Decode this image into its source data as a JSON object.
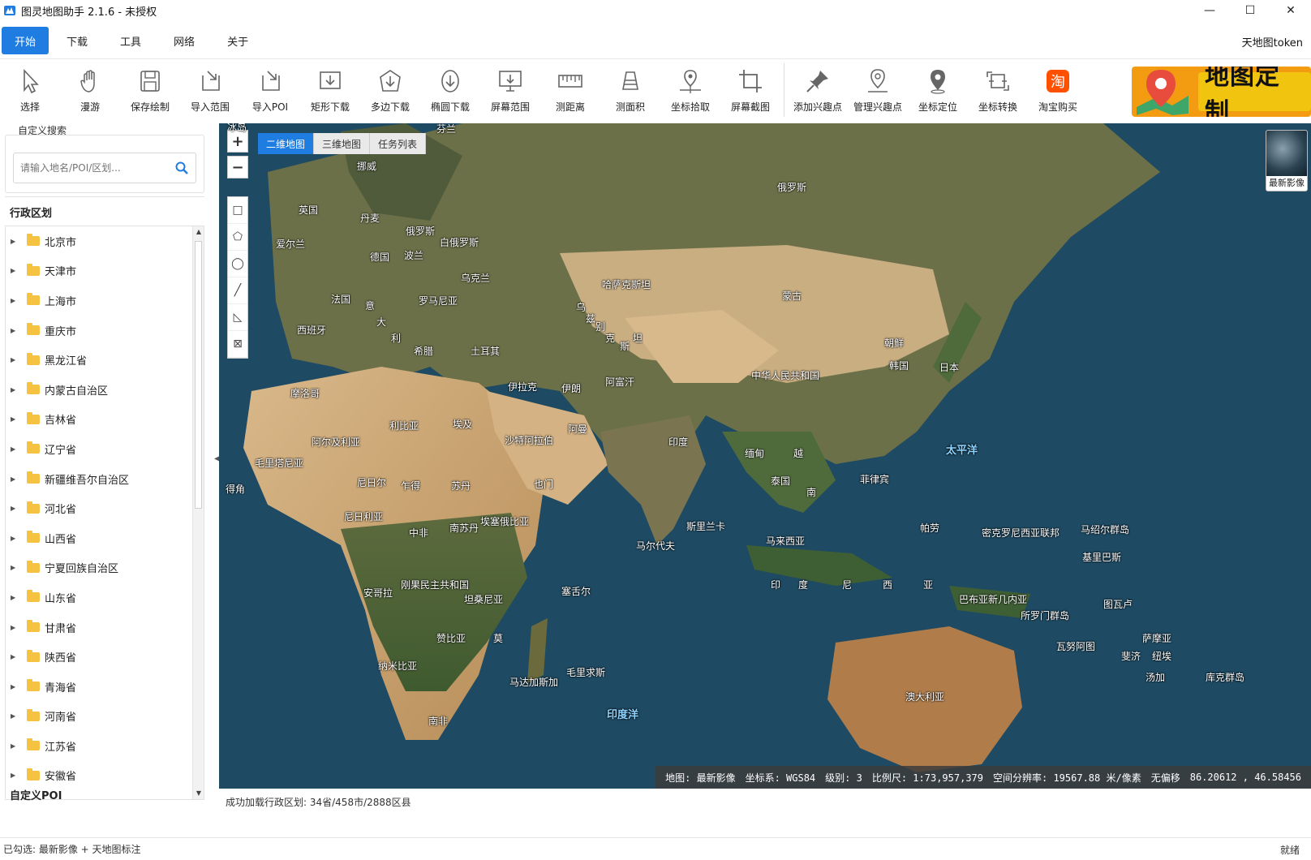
{
  "window": {
    "title": "图灵地图助手  2.1.6 - 未授权",
    "min": "—",
    "max": "☐",
    "close": "✕"
  },
  "menu": {
    "tabs": [
      "开始",
      "下载",
      "工具",
      "网络",
      "关于"
    ],
    "active": "开始",
    "token_label": "天地图token"
  },
  "toolbar": {
    "tools": [
      {
        "label": "选择",
        "icon": "cursor-icon"
      },
      {
        "label": "漫游",
        "icon": "hand-icon"
      },
      {
        "label": "保存绘制",
        "icon": "save-icon"
      },
      {
        "label": "导入范围",
        "icon": "import-range-icon"
      },
      {
        "label": "导入POI",
        "icon": "import-poi-icon"
      },
      {
        "label": "矩形下载",
        "icon": "rect-download-icon"
      },
      {
        "label": "多边下载",
        "icon": "polygon-download-icon"
      },
      {
        "label": "椭圆下载",
        "icon": "ellipse-download-icon"
      },
      {
        "label": "屏幕范围",
        "icon": "screen-range-icon"
      },
      {
        "label": "测距离",
        "icon": "ruler-icon"
      },
      {
        "label": "测面积",
        "icon": "area-icon"
      },
      {
        "label": "坐标拾取",
        "icon": "pick-coord-icon"
      },
      {
        "label": "屏幕截图",
        "icon": "crop-icon"
      }
    ],
    "tools2": [
      {
        "label": "添加兴趣点",
        "icon": "pin-add-icon"
      },
      {
        "label": "管理兴趣点",
        "icon": "pin-manage-icon"
      },
      {
        "label": "坐标定位",
        "icon": "locate-icon"
      },
      {
        "label": "坐标转换",
        "icon": "convert-icon"
      },
      {
        "label": "淘宝购买",
        "icon": "taobao-icon"
      }
    ],
    "banner_text": "地图定制",
    "taobao_glyph": "淘"
  },
  "sidebar": {
    "custom_search_title": "自定义搜索",
    "search_placeholder": "请输入地名/POI/区划...",
    "admin_title": "行政区划",
    "provinces": [
      "北京市",
      "天津市",
      "上海市",
      "重庆市",
      "黑龙江省",
      "内蒙古自治区",
      "吉林省",
      "辽宁省",
      "新疆维吾尔自治区",
      "河北省",
      "山西省",
      "宁夏回族自治区",
      "山东省",
      "甘肃省",
      "陕西省",
      "青海省",
      "河南省",
      "江苏省",
      "安徽省"
    ],
    "poi_title": "自定义POI"
  },
  "map": {
    "tabs": [
      "二维地图",
      "三维地图",
      "任务列表"
    ],
    "active_tab": "二维地图",
    "zoom_in": "+",
    "zoom_out": "−",
    "layer_caption": "最新影像",
    "labels": [
      {
        "text": "冰岛"
      },
      {
        "text": "芬兰"
      },
      {
        "text": "挪威"
      },
      {
        "text": "俄罗斯"
      },
      {
        "text": "英国"
      },
      {
        "text": "丹麦"
      },
      {
        "text": "俄罗斯"
      },
      {
        "text": "白俄罗斯"
      },
      {
        "text": "爱尔兰"
      },
      {
        "text": "德国"
      },
      {
        "text": "波兰"
      },
      {
        "text": "乌克兰"
      },
      {
        "text": "哈萨克斯坦"
      },
      {
        "text": "法国"
      },
      {
        "text": "罗马尼亚"
      },
      {
        "text": "蒙古"
      },
      {
        "text": "意"
      },
      {
        "text": "西班牙"
      },
      {
        "text": "大"
      },
      {
        "text": "利"
      },
      {
        "text": "希腊"
      },
      {
        "text": "土耳其"
      },
      {
        "text": "朝鲜"
      },
      {
        "text": "韩国"
      },
      {
        "text": "日本"
      },
      {
        "text": "摩洛哥"
      },
      {
        "text": "伊拉克"
      },
      {
        "text": "伊朗"
      },
      {
        "text": "阿富汗"
      },
      {
        "text": "中华人民共和国"
      },
      {
        "text": "阿尔及利亚"
      },
      {
        "text": "利比亚"
      },
      {
        "text": "埃及"
      },
      {
        "text": "沙特阿拉伯"
      },
      {
        "text": "阿曼"
      },
      {
        "text": "印度"
      },
      {
        "text": "缅甸"
      },
      {
        "text": "越"
      },
      {
        "text": "毛里塔尼亚"
      },
      {
        "text": "尼日尔"
      },
      {
        "text": "乍得"
      },
      {
        "text": "苏丹"
      },
      {
        "text": "也门"
      },
      {
        "text": "泰国"
      },
      {
        "text": "南"
      },
      {
        "text": "菲律宾"
      },
      {
        "text": "太平洋"
      },
      {
        "text": "尼日利亚"
      },
      {
        "text": "中非"
      },
      {
        "text": "南苏丹"
      },
      {
        "text": "埃塞俄比亚"
      },
      {
        "text": "斯里兰卡"
      },
      {
        "text": "马来西亚"
      },
      {
        "text": "帕劳"
      },
      {
        "text": "密克罗尼西亚联邦"
      },
      {
        "text": "马绍尔群岛"
      },
      {
        "text": "马尔代夫"
      },
      {
        "text": "基里巴斯"
      },
      {
        "text": "刚果民主共和国"
      },
      {
        "text": "安哥拉"
      },
      {
        "text": "坦桑尼亚"
      },
      {
        "text": "塞舌尔"
      },
      {
        "text": "巴布亚新几内亚"
      },
      {
        "text": "图瓦卢"
      },
      {
        "text": "所罗门群岛"
      },
      {
        "text": "赞比亚"
      },
      {
        "text": "莫"
      },
      {
        "text": "萨摩亚"
      },
      {
        "text": "瓦努阿图"
      },
      {
        "text": "斐济"
      },
      {
        "text": "纽埃"
      },
      {
        "text": "纳米比亚"
      },
      {
        "text": "毛里求斯"
      },
      {
        "text": "马达加斯加"
      },
      {
        "text": "汤加"
      },
      {
        "text": "库克群岛"
      },
      {
        "text": "澳大利亚"
      },
      {
        "text": "印度洋"
      },
      {
        "text": "南非"
      },
      {
        "text": "印"
      },
      {
        "text": "度"
      },
      {
        "text": "尼"
      },
      {
        "text": "西"
      },
      {
        "text": "亚"
      },
      {
        "text": "哈萨"
      },
      {
        "text": "得角"
      },
      {
        "text": "乌"
      },
      {
        "text": "兹"
      },
      {
        "text": "别"
      },
      {
        "text": "克"
      },
      {
        "text": "斯"
      },
      {
        "text": "坦"
      }
    ],
    "status": {
      "source": "地图: 最新影像",
      "crs": "坐标系: WGS84",
      "level": "级别: 3",
      "scale": "比例尺: 1:73,957,379",
      "resolution": "空间分辨率: 19567.88 米/像素",
      "offset": "无偏移",
      "coords": "86.20612 , 46.58456"
    }
  },
  "load_message": "成功加载行政区划: 34省/458市/2888区县",
  "statusbar": {
    "left": "已勾选: 最新影像 + 天地图标注",
    "right": "就绪"
  },
  "colors": {
    "accent": "#1f7ce0",
    "banner": "#f39c12",
    "folder": "#f5c242"
  }
}
